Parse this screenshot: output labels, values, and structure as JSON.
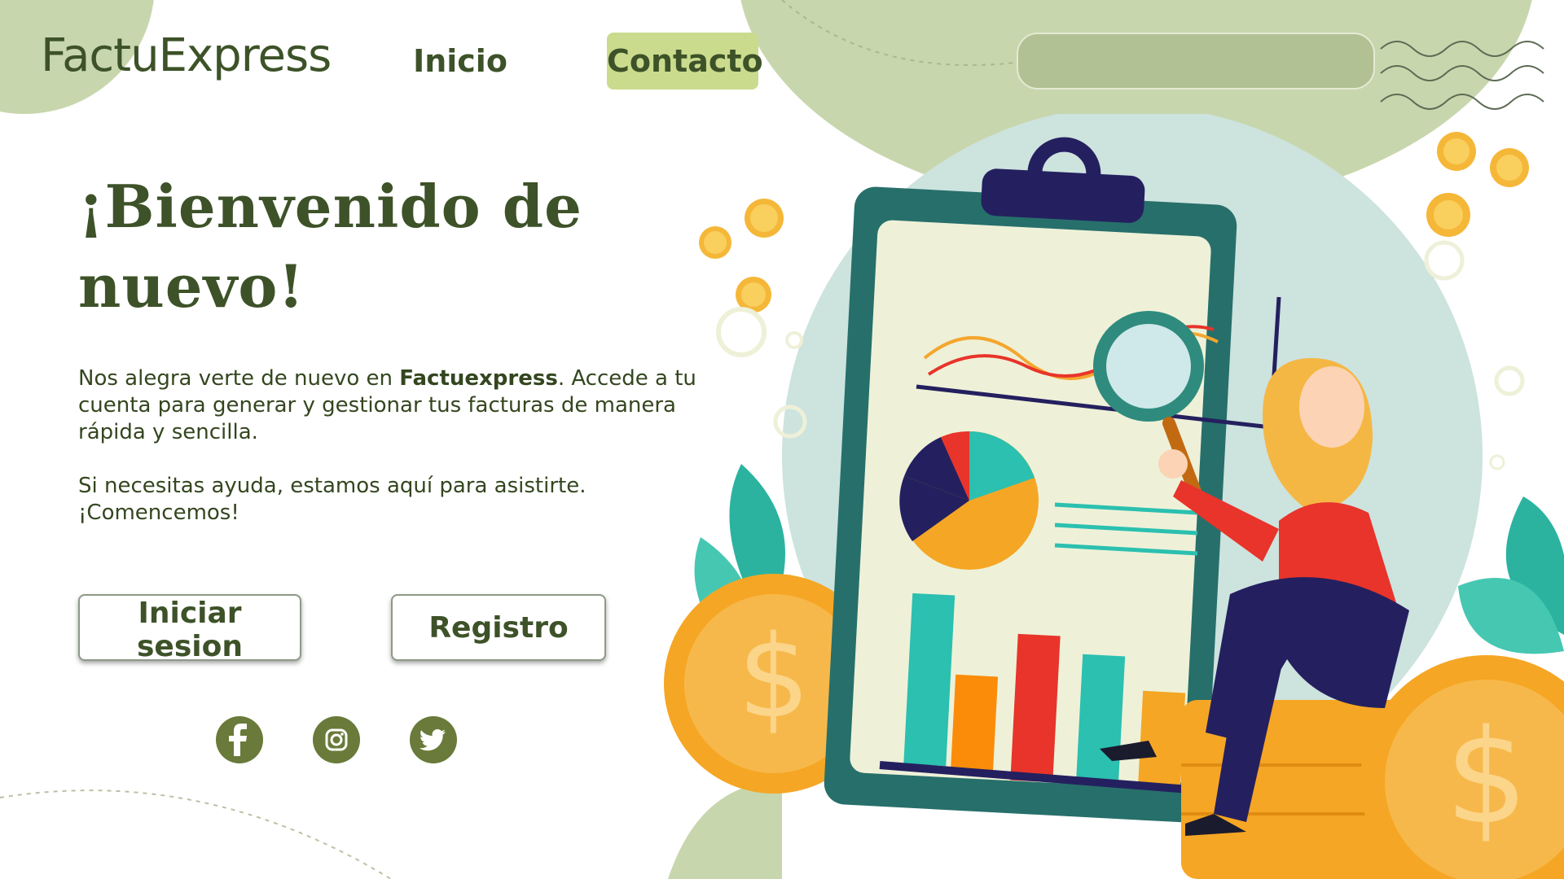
{
  "brand": {
    "name": "FactuExpress"
  },
  "nav": {
    "inicio_label": "Inicio",
    "contacto_label": "Contacto"
  },
  "search": {
    "placeholder": "",
    "value": ""
  },
  "hero": {
    "title": "¡Bienvenido de nuevo!",
    "p1_before": "Nos alegra verte de nuevo en ",
    "p1_bold": "Factuexpress",
    "p1_after": ". Accede a tu cuenta para generar y gestionar tus facturas de manera rápida y sencilla.",
    "p2": "Si necesitas ayuda, estamos aquí para asistirte. ¡Comencemos!"
  },
  "actions": {
    "login_label": "Iniciar sesion",
    "register_label": "Registro"
  },
  "social": {
    "facebook_icon": "facebook-icon",
    "instagram_icon": "instagram-icon",
    "twitter_icon": "twitter-icon"
  },
  "colors": {
    "primary_text": "#3d5228",
    "accent": "#cbdb8e",
    "blob": "#c8d6ad",
    "social_bg": "#697a3a"
  }
}
